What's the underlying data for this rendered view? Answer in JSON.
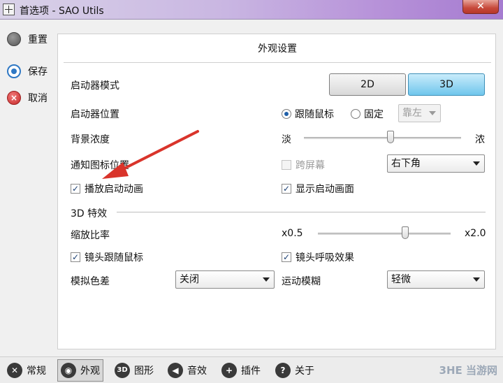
{
  "window": {
    "title": "首选项 - SAO Utils",
    "close_glyph": "✕"
  },
  "sidebar": {
    "items": [
      {
        "label": "重置",
        "icon": "gray-dot-icon"
      },
      {
        "label": "保存",
        "icon": "blue-ring-icon"
      },
      {
        "label": "取消",
        "icon": "red-x-icon"
      }
    ]
  },
  "panel": {
    "title": "外观设置",
    "launcher_mode": {
      "label": "启动器模式",
      "option_2d": "2D",
      "option_3d": "3D",
      "selected": "3D"
    },
    "launcher_position": {
      "label": "启动器位置",
      "follow_mouse": "跟随鼠标",
      "fixed": "固定",
      "fixed_select": "靠左",
      "selected": "跟随鼠标"
    },
    "background_density": {
      "label": "背景浓度",
      "min_label": "淡",
      "max_label": "浓",
      "value_fraction": 0.55
    },
    "notify_icon_position": {
      "label": "通知图标位置",
      "cross_screen": "跨屏幕",
      "corner_select": "右下角"
    },
    "play_launch_animation": {
      "label": "播放启动动画",
      "checked": true
    },
    "show_launch_screen": {
      "label": "显示启动画面",
      "checked": true
    },
    "section_3d": "3D 特效",
    "zoom_ratio": {
      "label": "缩放比率",
      "min_label": "x0.5",
      "max_label": "x2.0",
      "value_fraction": 0.66
    },
    "lens_follow_mouse": {
      "label": "镜头跟随鼠标",
      "checked": true
    },
    "lens_breathing": {
      "label": "镜头呼吸效果",
      "checked": true
    },
    "chromatic_aberration": {
      "label": "模拟色差",
      "value": "关闭"
    },
    "motion_blur": {
      "label": "运动模糊",
      "value": "轻微"
    }
  },
  "bottom_tabs": [
    {
      "label": "常规",
      "icon": "wrench-icon"
    },
    {
      "label": "外观",
      "icon": "eye-icon",
      "active": true
    },
    {
      "label": "图形",
      "icon": "3d-icon"
    },
    {
      "label": "音效",
      "icon": "speaker-icon"
    },
    {
      "label": "插件",
      "icon": "plus-icon"
    },
    {
      "label": "关于",
      "icon": "question-icon"
    }
  ],
  "watermark": "3HE 当游网",
  "colors": {
    "accent_blue": "#6fc6ec",
    "annotation_red": "#d9342b"
  }
}
